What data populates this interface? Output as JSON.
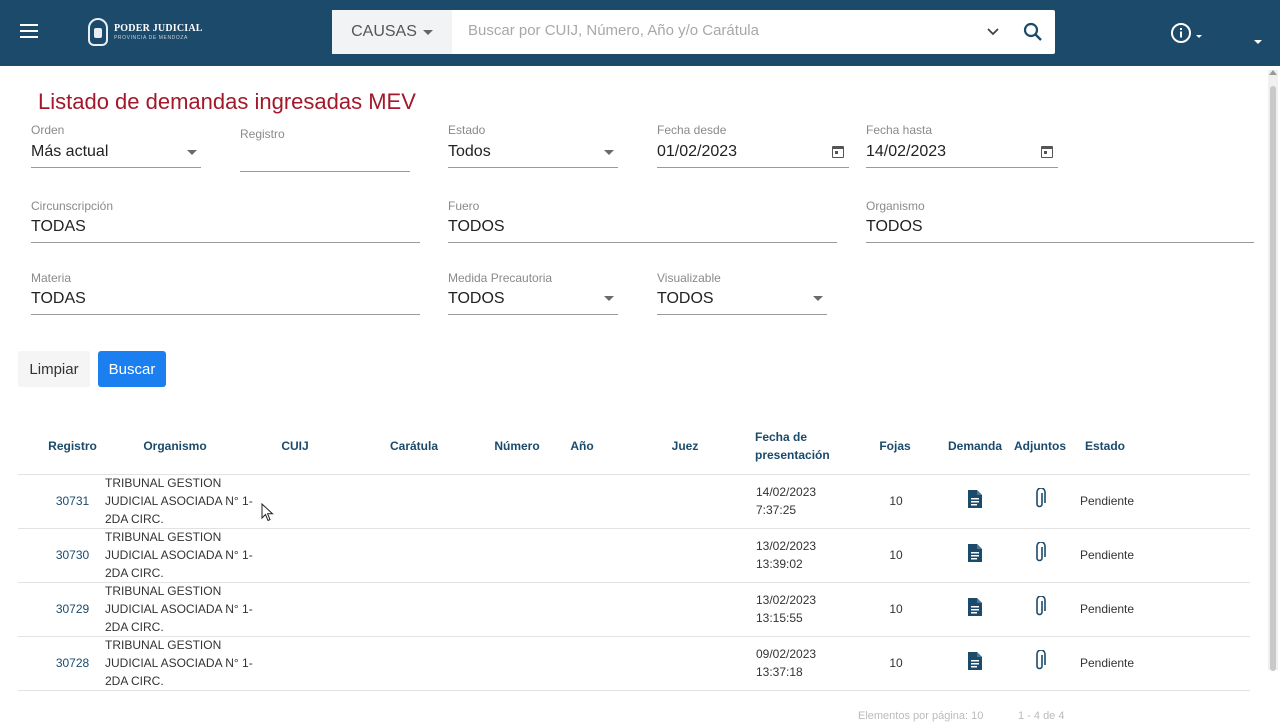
{
  "header": {
    "logo_title": "PODER JUDICIAL",
    "logo_subtitle": "PROVINCIA DE MENDOZA",
    "search_type": "CAUSAS",
    "search_placeholder": "Buscar por CUIJ, Número, Año y/o Carátula"
  },
  "page_title": "Listado de demandas ingresadas MEV",
  "filters": {
    "orden": {
      "label": "Orden",
      "value": "Más actual"
    },
    "registro": {
      "label": "Registro",
      "value": ""
    },
    "estado": {
      "label": "Estado",
      "value": "Todos"
    },
    "fecha_desde": {
      "label": "Fecha desde",
      "value": "01/02/2023"
    },
    "fecha_hasta": {
      "label": "Fecha hasta",
      "value": "14/02/2023"
    },
    "circunscripcion": {
      "label": "Circunscripción",
      "value": "TODAS"
    },
    "fuero": {
      "label": "Fuero",
      "value": "TODOS"
    },
    "organismo": {
      "label": "Organismo",
      "value": "TODOS"
    },
    "materia": {
      "label": "Materia",
      "value": "TODAS"
    },
    "medida_precautoria": {
      "label": "Medida Precautoria",
      "value": "TODOS"
    },
    "visualizable": {
      "label": "Visualizable",
      "value": "TODOS"
    }
  },
  "buttons": {
    "clear": "Limpiar",
    "search": "Buscar"
  },
  "table": {
    "headers": {
      "registro": "Registro",
      "organismo": "Organismo",
      "cuij": "CUIJ",
      "caratula": "Carátula",
      "numero": "Número",
      "anio": "Año",
      "juez": "Juez",
      "fecha_line1": "Fecha de",
      "fecha_line2": "presentación",
      "fojas": "Fojas",
      "demanda": "Demanda",
      "adjuntos": "Adjuntos",
      "estado": "Estado"
    },
    "rows": [
      {
        "registro": "30731",
        "org1": "TRIBUNAL GESTION",
        "org2": "JUDICIAL ASOCIADA N° 1-",
        "org3": "2DA CIRC.",
        "fecha1": "14/02/2023",
        "fecha2": "7:37:25",
        "fojas": "10",
        "estado": "Pendiente"
      },
      {
        "registro": "30730",
        "org1": "TRIBUNAL GESTION",
        "org2": "JUDICIAL ASOCIADA N° 1-",
        "org3": "2DA CIRC.",
        "fecha1": "13/02/2023",
        "fecha2": "13:39:02",
        "fojas": "10",
        "estado": "Pendiente"
      },
      {
        "registro": "30729",
        "org1": "TRIBUNAL GESTION",
        "org2": "JUDICIAL ASOCIADA N° 1-",
        "org3": "2DA CIRC.",
        "fecha1": "13/02/2023",
        "fecha2": "13:15:55",
        "fojas": "10",
        "estado": "Pendiente"
      },
      {
        "registro": "30728",
        "org1": "TRIBUNAL GESTION",
        "org2": "JUDICIAL ASOCIADA N° 1-",
        "org3": "2DA CIRC.",
        "fecha1": "09/02/2023",
        "fecha2": "13:37:18",
        "fojas": "10",
        "estado": "Pendiente"
      }
    ]
  },
  "footer": {
    "per_page": "Elementos por página: 10",
    "range": "1 - 4 de 4"
  },
  "colors": {
    "header_bg": "#1b4a6b",
    "title": "#a3182a",
    "primary_button": "#1b7ff0",
    "table_header": "#1b4a6b"
  }
}
